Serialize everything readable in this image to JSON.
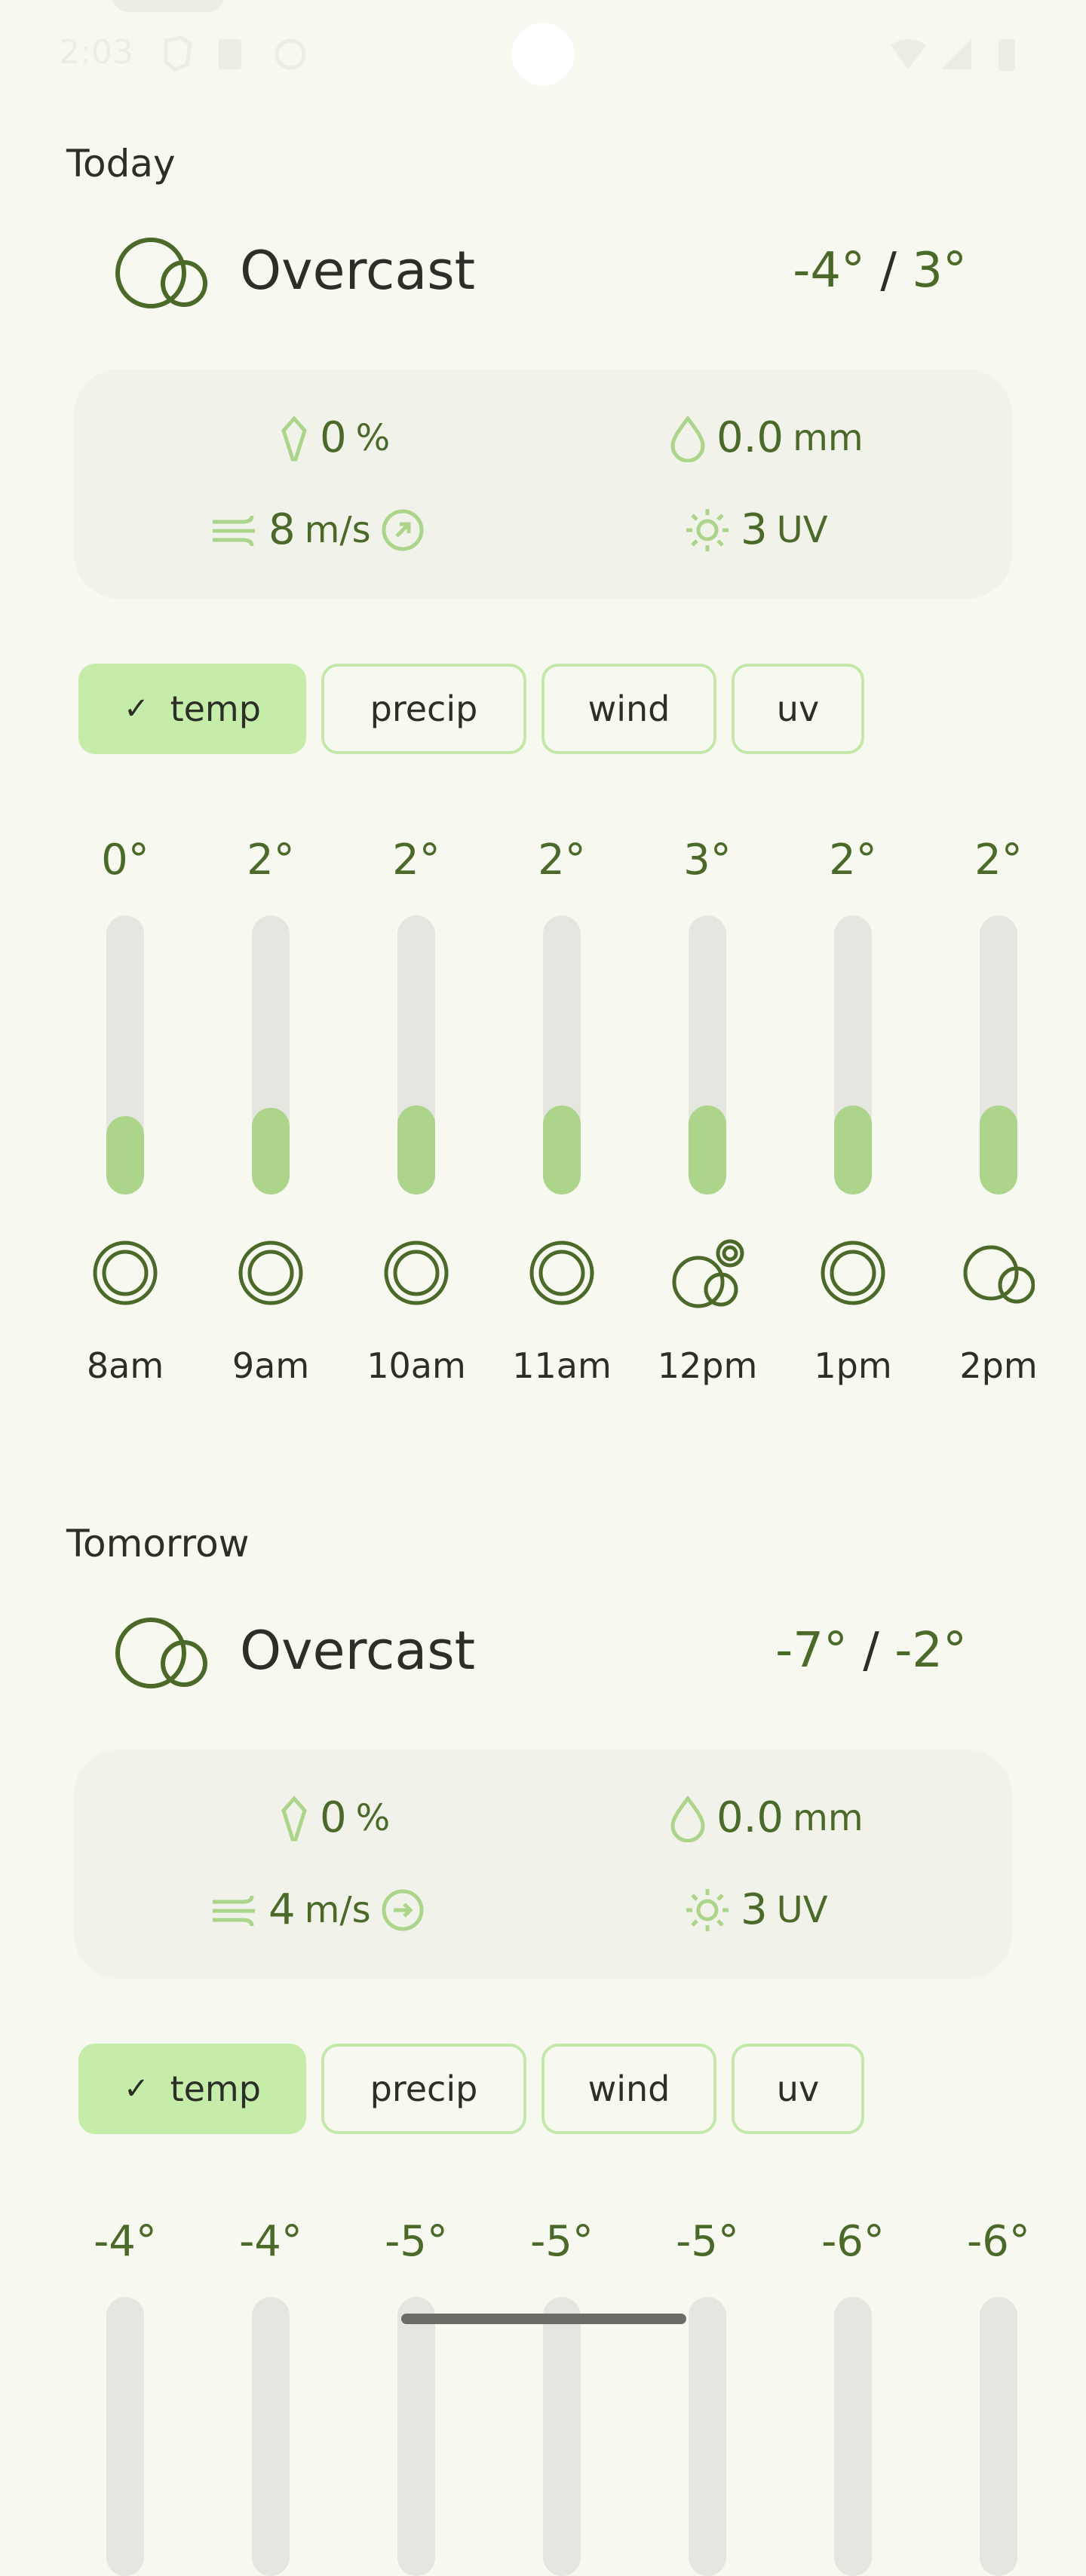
{
  "status_bar": {
    "time": "2:03"
  },
  "days": [
    {
      "label": "Today",
      "condition": "Overcast",
      "temp_low": "-4°",
      "temp_sep": "/",
      "temp_high": "3°",
      "stats": {
        "precip_chance": "0",
        "precip_chance_unit": "%",
        "precip_amount": "0.0",
        "precip_amount_unit": "mm",
        "wind": "8",
        "wind_unit": "m/s",
        "uv": "3",
        "uv_unit": "UV"
      },
      "chips": [
        {
          "label": "temp",
          "selected": true
        },
        {
          "label": "precip",
          "selected": false
        },
        {
          "label": "wind",
          "selected": false
        },
        {
          "label": "uv",
          "selected": false
        }
      ],
      "hourly": [
        {
          "time": "8am",
          "temp": "0°",
          "level": 0.28,
          "icon": "clear-ring-icon"
        },
        {
          "time": "9am",
          "temp": "2°",
          "level": 0.31,
          "icon": "clear-ring-icon"
        },
        {
          "time": "10am",
          "temp": "2°",
          "level": 0.32,
          "icon": "clear-ring-icon"
        },
        {
          "time": "11am",
          "temp": "2°",
          "level": 0.32,
          "icon": "clear-ring-icon"
        },
        {
          "time": "12pm",
          "temp": "3°",
          "level": 0.32,
          "icon": "partly-cloudy-icon"
        },
        {
          "time": "1pm",
          "temp": "2°",
          "level": 0.32,
          "icon": "clear-ring-icon"
        },
        {
          "time": "2pm",
          "temp": "2°",
          "level": 0.32,
          "icon": "overcast-icon"
        }
      ]
    },
    {
      "label": "Tomorrow",
      "condition": "Overcast",
      "temp_low": "-7°",
      "temp_sep": "/",
      "temp_high": "-2°",
      "stats": {
        "precip_chance": "0",
        "precip_chance_unit": "%",
        "precip_amount": "0.0",
        "precip_amount_unit": "mm",
        "wind": "4",
        "wind_unit": "m/s",
        "uv": "3",
        "uv_unit": "UV"
      },
      "chips": [
        {
          "label": "temp",
          "selected": true
        },
        {
          "label": "precip",
          "selected": false
        },
        {
          "label": "wind",
          "selected": false
        },
        {
          "label": "uv",
          "selected": false
        }
      ],
      "hourly": [
        {
          "temp": "-4°"
        },
        {
          "temp": "-4°"
        },
        {
          "temp": "-5°"
        },
        {
          "temp": "-5°"
        },
        {
          "temp": "-5°"
        },
        {
          "temp": "-6°"
        },
        {
          "temp": "-6°"
        }
      ]
    }
  ],
  "colors": {
    "background": "#f7f8ef",
    "accent_text": "#4b6a2a",
    "chip_selected": "#c6eca9",
    "bar_fill": "#acd48b",
    "card": "#f1f3ea"
  }
}
